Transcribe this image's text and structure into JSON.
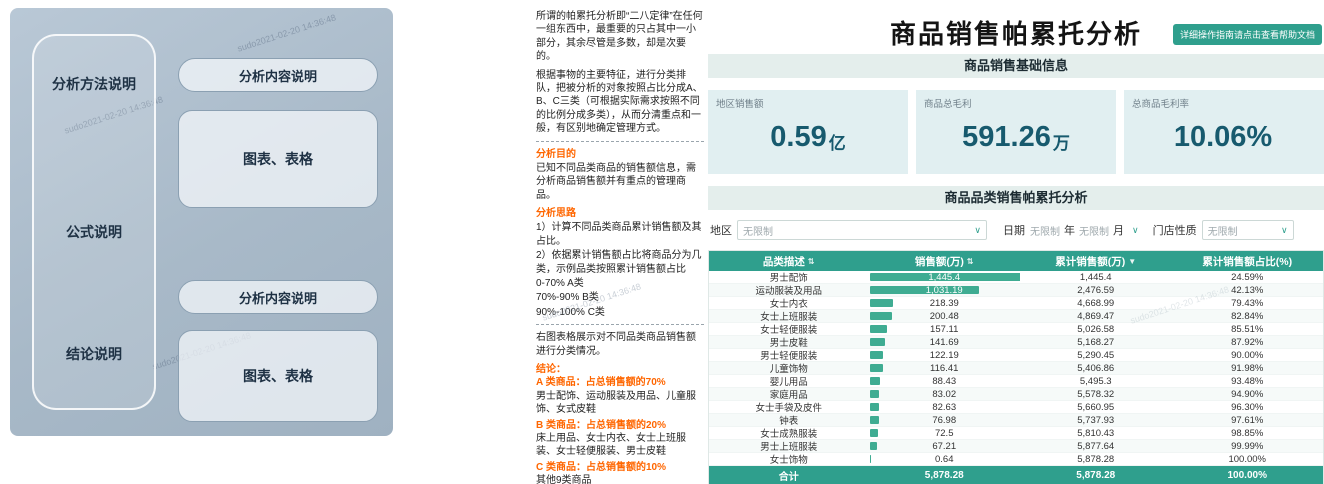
{
  "watermark": "sudo2021-02-20 14:36:48",
  "colors": {
    "accent_teal": "#2f9f8d",
    "bar_green": "#3fac92",
    "light_teal_bg": "#e4eeec",
    "kpi_bg": "#e1eff1",
    "kpi_value": "#175a6e",
    "orange": "#ff6600"
  },
  "icons": {
    "sort": "⇅",
    "sort_desc": "▼",
    "chevron": "∨"
  },
  "diagram": {
    "left_box_items": [
      "分析方法说明",
      "公式说明",
      "结论说明"
    ],
    "right_items": [
      {
        "label": "分析内容说明",
        "shape": "pill"
      },
      {
        "label": "图表、表格",
        "shape": "box"
      },
      {
        "label": "分析内容说明",
        "shape": "pill"
      },
      {
        "label": "图表、表格",
        "shape": "box"
      }
    ]
  },
  "sidebar": {
    "intro_1": "所谓的帕累托分析即“二八定律”在任何一组东西中，最重要的只占其中一小部分，其余尽管是多数，却是次要的。",
    "intro_2": "根据事物的主要特征，进行分类排队，把被分析的对象按照占比分成A、B、C三类（可根据实际需求按照不同的比例分成多类），从而分清重点和一般，有区别地确定管理方式。",
    "purpose_title": "分析目的",
    "purpose_text": "已知不同品类商品的销售额信息，需分析商品销售额并有重点的管理商品。",
    "approach_title": "分析思路",
    "approach_lines": [
      "1）计算不同品类商品累计销售额及其占比。",
      "2）依据累计销售额占比将商品分为几类，示例品类按照累计销售额占比",
      "0-70% A类",
      "70%-90% B类",
      "90%-100% C类"
    ],
    "result_intro": "右图表格展示对不同品类商品销售额进行分类情况。",
    "conclusion_title": "结论：",
    "conclusions": [
      {
        "title": "A 类商品：占总销售额的70%",
        "detail": "男士配饰、运动服装及用品、儿童服饰、女式皮鞋"
      },
      {
        "title": "B 类商品：占总销售额的20%",
        "detail": "床上用品、女士内衣、女士上班服装、女士轻便服装、男士皮鞋"
      },
      {
        "title": "C 类商品：占总销售额的10%",
        "detail": "其他9类商品"
      }
    ]
  },
  "header": {
    "title": "商品销售帕累托分析",
    "help_button": "详细操作指南请点击查看帮助文档"
  },
  "sections": {
    "basic_info": "商品销售基础信息",
    "pareto": "商品品类销售帕累托分析"
  },
  "kpis": [
    {
      "label": "地区销售额",
      "value": "0.59",
      "unit": "亿"
    },
    {
      "label": "商品总毛利",
      "value": "591.26",
      "unit": "万"
    },
    {
      "label": "总商品毛利率",
      "value": "10.06%",
      "unit": ""
    }
  ],
  "filters": {
    "region_label": "地区",
    "region_value": "无限制",
    "date_label": "日期",
    "date_year_value": "无限制",
    "date_year_unit": "年",
    "date_month_value": "无限制",
    "date_month_unit": "月",
    "store_label": "门店性质",
    "store_value": "无限制"
  },
  "table": {
    "headers": [
      "品类描述",
      "销售额(万)",
      "累计销售额(万)",
      "累计销售额占比(%)"
    ],
    "rows": [
      {
        "category": "男士配饰",
        "sales": "1,445.4",
        "cumulative": "1,445.4",
        "pct": "24.59%",
        "bar_pct": 100,
        "on_bar": true
      },
      {
        "category": "运动服装及用品",
        "sales": "1,031.19",
        "cumulative": "2,476.59",
        "pct": "42.13%",
        "bar_pct": 71.3,
        "on_bar": true
      },
      {
        "category": "女士内衣",
        "sales": "218.39",
        "cumulative": "4,668.99",
        "pct": "79.43%",
        "bar_pct": 15.1,
        "on_bar": false
      },
      {
        "category": "女士上班服装",
        "sales": "200.48",
        "cumulative": "4,869.47",
        "pct": "82.84%",
        "bar_pct": 13.9,
        "on_bar": false
      },
      {
        "category": "女士轻便服装",
        "sales": "157.11",
        "cumulative": "5,026.58",
        "pct": "85.51%",
        "bar_pct": 10.9,
        "on_bar": false
      },
      {
        "category": "男士皮鞋",
        "sales": "141.69",
        "cumulative": "5,168.27",
        "pct": "87.92%",
        "bar_pct": 9.8,
        "on_bar": false
      },
      {
        "category": "男士轻便服装",
        "sales": "122.19",
        "cumulative": "5,290.45",
        "pct": "90.00%",
        "bar_pct": 8.5,
        "on_bar": false
      },
      {
        "category": "儿童饰物",
        "sales": "116.41",
        "cumulative": "5,406.86",
        "pct": "91.98%",
        "bar_pct": 8.1,
        "on_bar": false
      },
      {
        "category": "婴儿用品",
        "sales": "88.43",
        "cumulative": "5,495.3",
        "pct": "93.48%",
        "bar_pct": 6.1,
        "on_bar": false
      },
      {
        "category": "家庭用品",
        "sales": "83.02",
        "cumulative": "5,578.32",
        "pct": "94.90%",
        "bar_pct": 5.7,
        "on_bar": false
      },
      {
        "category": "女士手袋及皮件",
        "sales": "82.63",
        "cumulative": "5,660.95",
        "pct": "96.30%",
        "bar_pct": 5.7,
        "on_bar": false
      },
      {
        "category": "钟表",
        "sales": "76.98",
        "cumulative": "5,737.93",
        "pct": "97.61%",
        "bar_pct": 5.3,
        "on_bar": false
      },
      {
        "category": "女士成熟服装",
        "sales": "72.5",
        "cumulative": "5,810.43",
        "pct": "98.85%",
        "bar_pct": 5.0,
        "on_bar": false
      },
      {
        "category": "男士上班服装",
        "sales": "67.21",
        "cumulative": "5,877.64",
        "pct": "99.99%",
        "bar_pct": 4.6,
        "on_bar": false
      },
      {
        "category": "女士饰物",
        "sales": "0.64",
        "cumulative": "5,878.28",
        "pct": "100.00%",
        "bar_pct": 0.5,
        "on_bar": false
      }
    ],
    "total": {
      "category": "合计",
      "sales": "5,878.28",
      "cumulative": "5,878.28",
      "pct": "100.00%"
    }
  }
}
